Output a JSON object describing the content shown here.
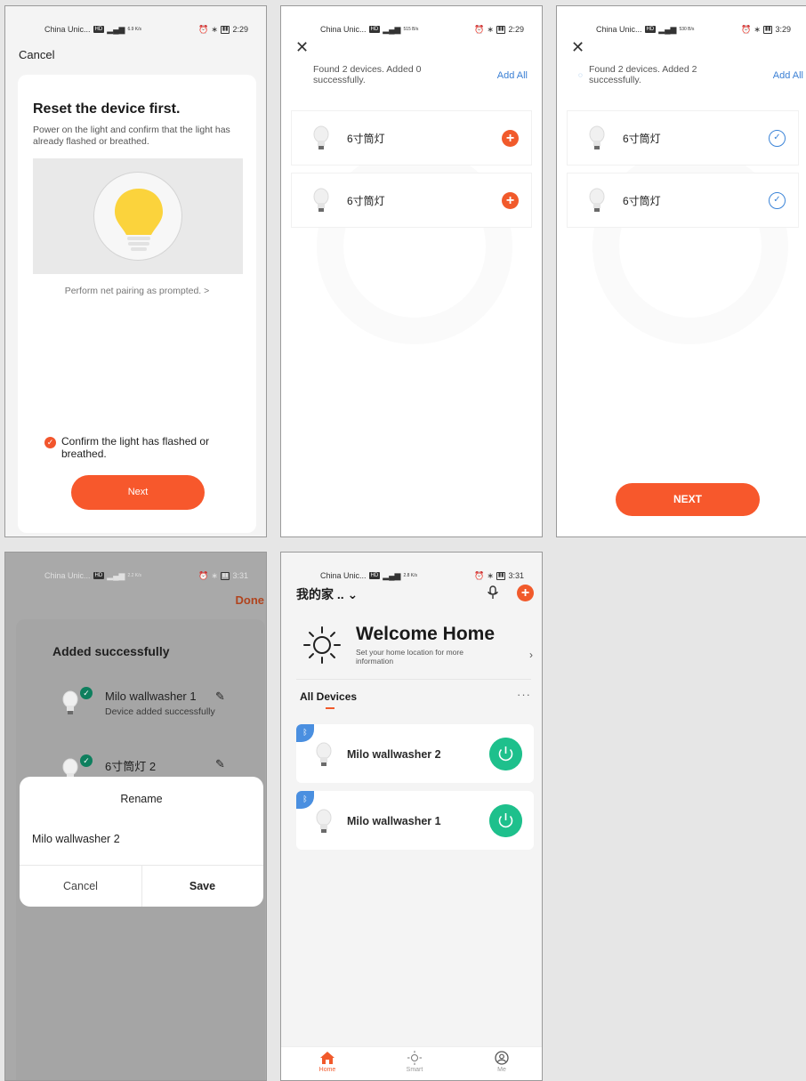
{
  "screen1": {
    "status": {
      "carrier": "China Unic...",
      "speed": "6.9 K/s",
      "time": "2:29"
    },
    "cancel": "Cancel",
    "title": "Reset the device first.",
    "description": "Power on the light and confirm that the light has already flashed or breathed.",
    "prompt": "Perform net pairing as prompted.",
    "prompt_chevron": ">",
    "confirm_label": "Confirm the light has flashed or breathed.",
    "check_glyph": "✓",
    "next": "Next"
  },
  "screen2": {
    "status": {
      "carrier": "China Unic...",
      "speed": "515 B/s",
      "time": "2:29"
    },
    "close": "✕",
    "message": "Found 2 devices. Added 0 successfully.",
    "add_all": "Add All",
    "devices": [
      {
        "name": "6寸筒灯",
        "action": "+"
      },
      {
        "name": "6寸筒灯",
        "action": "+"
      }
    ]
  },
  "screen3": {
    "status": {
      "carrier": "China Unic...",
      "speed": "530 B/s",
      "time": "3:29"
    },
    "close": "✕",
    "message": "Found 2 devices. Added 2 successfully.",
    "add_all": "Add All",
    "devices": [
      {
        "name": "6寸筒灯",
        "action": "✓"
      },
      {
        "name": "6寸筒灯",
        "action": "✓"
      }
    ],
    "next": "NEXT"
  },
  "screen4": {
    "status": {
      "carrier": "China Unic...",
      "speed": "2.2 K/s",
      "time": "3:31"
    },
    "done": "Done",
    "added_title": "Added successfully",
    "devices": [
      {
        "name": "Milo wallwasher 1",
        "status": "Device added successfully",
        "check": "✓"
      },
      {
        "name": "6寸筒灯 2",
        "check": "✓"
      }
    ],
    "dialog": {
      "title": "Rename",
      "value": "Milo wallwasher 2",
      "cancel": "Cancel",
      "save": "Save"
    }
  },
  "screen5": {
    "status": {
      "carrier": "China Unic...",
      "speed": "2.8 K/s",
      "time": "3:31"
    },
    "home_name": "我的家 .. ⌄",
    "add_glyph": "+",
    "welcome": "Welcome Home",
    "welcome_sub": "Set your home location for more information",
    "arrow": "›",
    "all_devices": "All Devices",
    "more": "···",
    "devices": [
      {
        "name": "Milo wallwasher 2",
        "bt": "ᛒ"
      },
      {
        "name": "Milo wallwasher 1",
        "bt": "ᛒ"
      }
    ],
    "tabs": [
      {
        "label": "Home"
      },
      {
        "label": "Smart"
      },
      {
        "label": "Me"
      }
    ]
  },
  "colors": {
    "accent": "#f7582c",
    "blue": "#3a7fd4",
    "green": "#1ec08c"
  }
}
